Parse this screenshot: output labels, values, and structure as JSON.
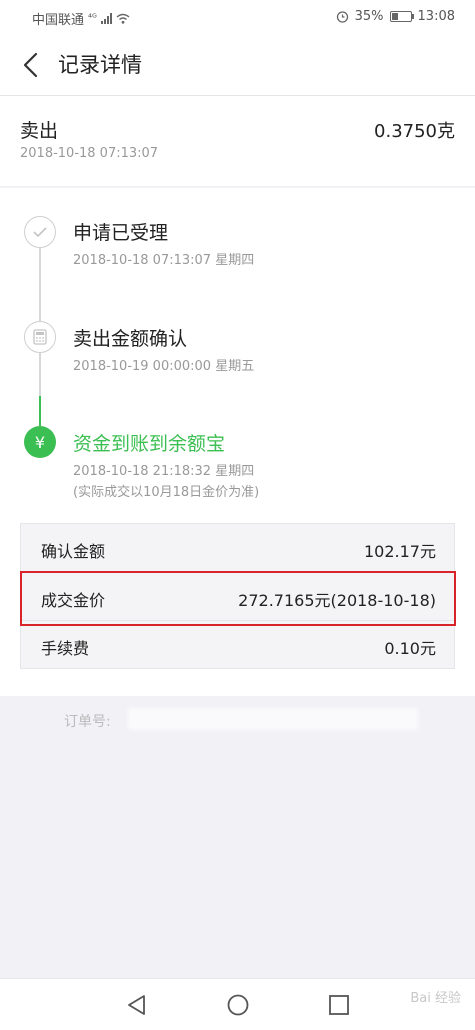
{
  "status_bar": {
    "carrier": "中国联通",
    "network": "⁴ᴳ",
    "battery": "35%",
    "battery_level": 0.35,
    "time": "13:08"
  },
  "header": {
    "title": "记录详情",
    "back_icon": "chevron-left-icon"
  },
  "summary": {
    "type": "卖出",
    "time": "2018-10-18 07:13:07",
    "amount": "0.3750克"
  },
  "timeline": [
    {
      "title": "申请已受理",
      "time": "2018-10-18 07:13:07 星期四",
      "icon": "check-circle-icon",
      "state": "done"
    },
    {
      "title": "卖出金额确认",
      "time": "2018-10-19 00:00:00 星期五",
      "icon": "calculator-icon",
      "state": "done"
    },
    {
      "title": "资金到账到余额宝",
      "time": "2018-10-18 21:18:32 星期四",
      "note": "(实际成交以10月18日金价为准)",
      "icon": "yuan-circle-icon",
      "state": "active"
    }
  ],
  "details": [
    {
      "label": "确认金额",
      "value": "102.17元"
    },
    {
      "label": "成交金价",
      "value": "272.7165元(2018-10-18)"
    },
    {
      "label": "手续费",
      "value": "0.10元"
    }
  ],
  "order": {
    "label": "订单号:"
  },
  "bottom_nav": [
    "back-triangle-icon",
    "home-circle-icon",
    "recents-square-icon"
  ],
  "watermark": "Bai 经验",
  "colors": {
    "accent_green": "#3cbf52",
    "highlight_red": "#d9232b"
  }
}
